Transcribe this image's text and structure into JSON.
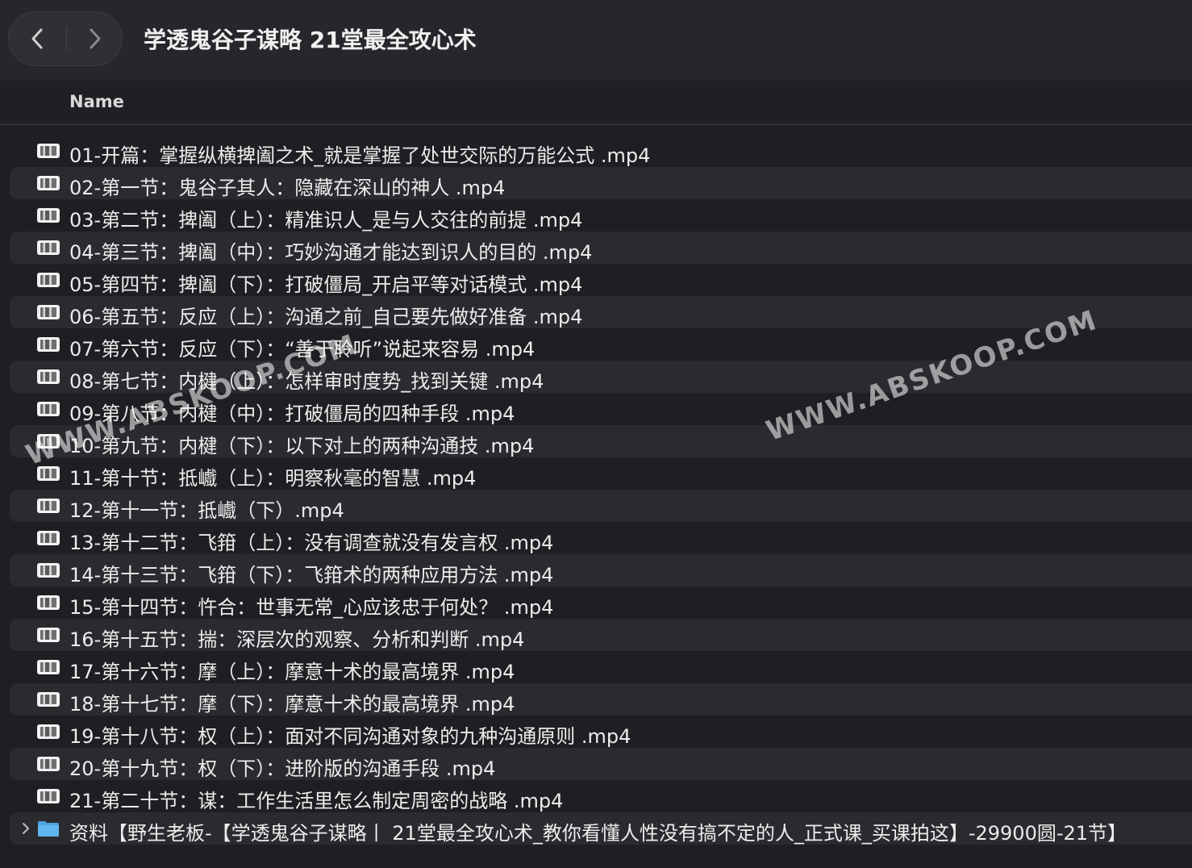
{
  "window": {
    "title": "学透鬼谷子谋略 21堂最全攻心术"
  },
  "list_header": {
    "name_label": "Name"
  },
  "files": [
    {
      "name": "01-开篇：掌握纵横捭阖之术_就是掌握了处世交际的万能公式 .mp4",
      "icon": "video-file-icon"
    },
    {
      "name": "02-第一节：鬼谷子其人：隐藏在深山的神人 .mp4",
      "icon": "video-file-icon"
    },
    {
      "name": "03-第二节：捭阖（上）：精准识人_是与人交往的前提 .mp4",
      "icon": "video-file-icon"
    },
    {
      "name": "04-第三节：捭阖（中）：巧妙沟通才能达到识人的目的 .mp4",
      "icon": "video-file-icon"
    },
    {
      "name": "05-第四节：捭阖（下）：打破僵局_开启平等对话模式 .mp4",
      "icon": "video-file-icon"
    },
    {
      "name": "06-第五节：反应（上）：沟通之前_自己要先做好准备 .mp4",
      "icon": "video-file-icon"
    },
    {
      "name": "07-第六节：反应（下）：“善于聆听”说起来容易 .mp4",
      "icon": "video-file-icon"
    },
    {
      "name": "08-第七节：内楗（上）：怎样审时度势_找到关键 .mp4",
      "icon": "video-file-icon"
    },
    {
      "name": "09-第八节：内楗（中）：打破僵局的四种手段 .mp4",
      "icon": "video-file-icon"
    },
    {
      "name": "10-第九节：内楗（下）：以下对上的两种沟通技 .mp4",
      "icon": "video-file-icon"
    },
    {
      "name": "11-第十节：抵巇（上）：明察秋毫的智慧 .mp4",
      "icon": "video-file-icon"
    },
    {
      "name": "12-第十一节：抵巇（下）.mp4",
      "icon": "video-file-icon"
    },
    {
      "name": "13-第十二节：飞箝（上）：没有调查就没有发言权 .mp4",
      "icon": "video-file-icon"
    },
    {
      "name": "14-第十三节：飞箝（下）：飞箝术的两种应用方法 .mp4",
      "icon": "video-file-icon"
    },
    {
      "name": "15-第十四节：忤合：世事无常_心应该忠于何处？ .mp4",
      "icon": "video-file-icon"
    },
    {
      "name": "16-第十五节：揣：深层次的观察、分析和判断 .mp4",
      "icon": "video-file-icon"
    },
    {
      "name": "17-第十六节：摩（上）：摩意十术的最高境界 .mp4",
      "icon": "video-file-icon"
    },
    {
      "name": "18-第十七节：摩（下）：摩意十术的最高境界 .mp4",
      "icon": "video-file-icon"
    },
    {
      "name": "19-第十八节：权（上）：面对不同沟通对象的九种沟通原则 .mp4",
      "icon": "video-file-icon"
    },
    {
      "name": "20-第十九节：权（下）：进阶版的沟通手段 .mp4",
      "icon": "video-file-icon"
    },
    {
      "name": "21-第二十节：谋：工作生活里怎么制定周密的战略 .mp4",
      "icon": "video-file-icon"
    }
  ],
  "folder": {
    "name": "资料【野生老板-【学透鬼谷子谋略丨 21堂最全攻心术_教你看懂人性没有搞不定的人_正式课_买课拍这】-29900圆-21节】",
    "icon": "folder-icon",
    "color": "#4aa3e0"
  },
  "watermarks": [
    "WWW.ABSKOOP.COM",
    "WWW.ABSKOOP.COM"
  ],
  "colors": {
    "background": "#1e1f22",
    "alt_row": "#2a2b2f",
    "text": "#ececec"
  }
}
